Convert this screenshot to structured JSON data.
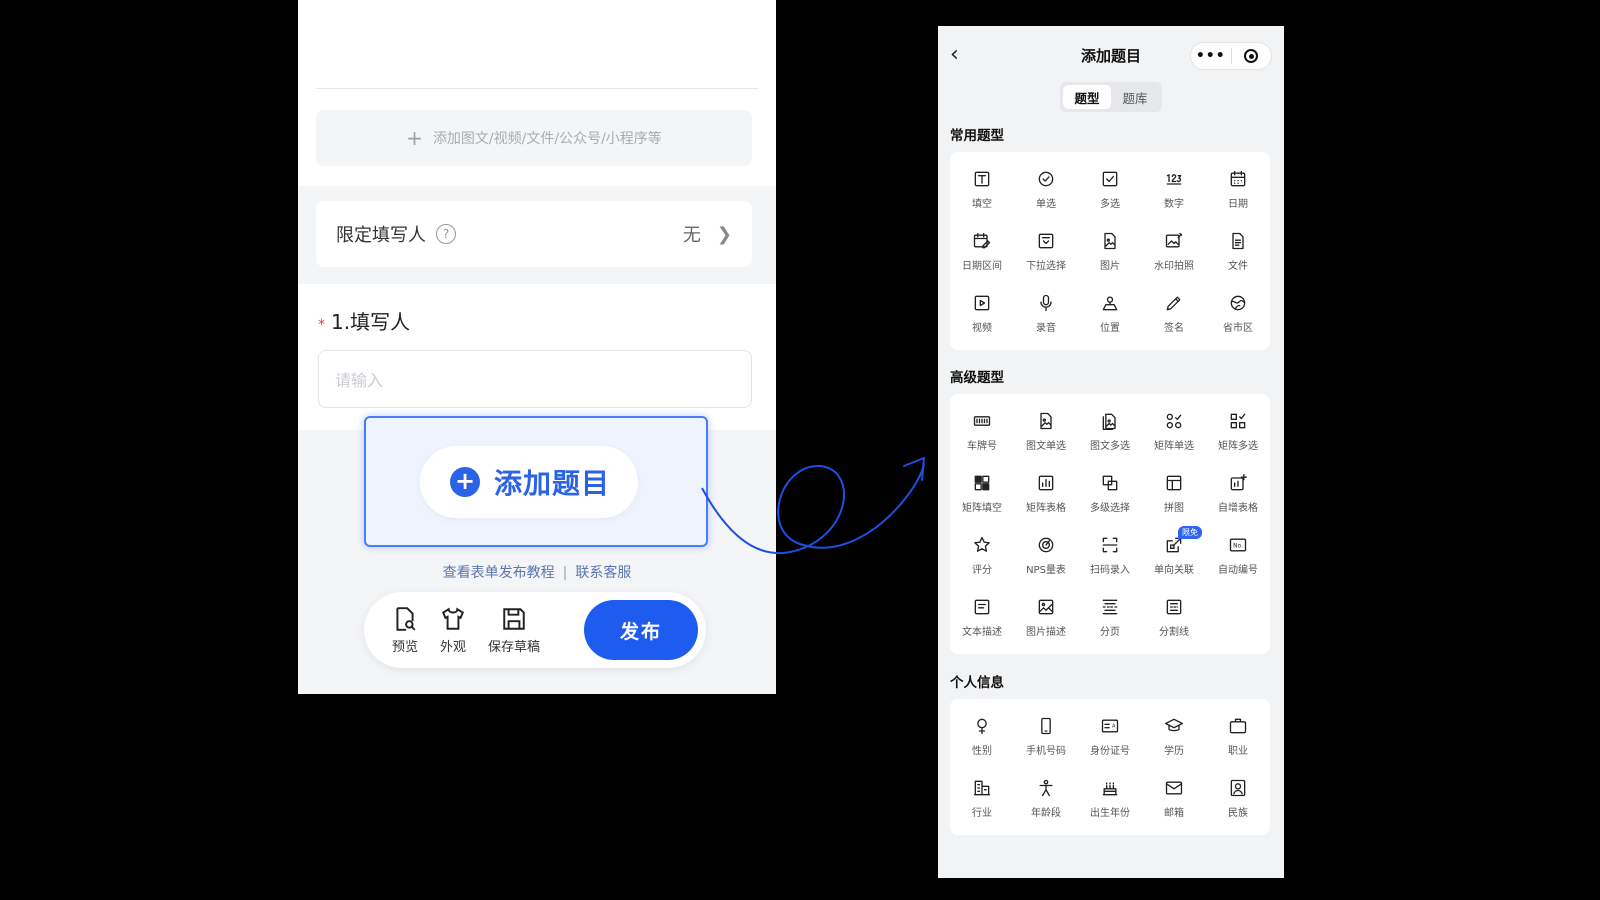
{
  "left": {
    "attach_text": "添加图文/视频/文件/公众号/小程序等",
    "limit_label": "限定填写人",
    "limit_value": "无",
    "question_title": "1.填写人",
    "required_mark": "*",
    "input_placeholder": "请输入",
    "add_question": "添加题目",
    "help_tutorial": "查看表单发布教程",
    "help_sep": "|",
    "help_contact": "联系客服",
    "toolbar": {
      "preview": "预览",
      "appearance": "外观",
      "save_draft": "保存草稿",
      "publish": "发布"
    }
  },
  "right": {
    "title": "添加题目",
    "more_icon": "•••",
    "tabs": [
      "题型",
      "题库"
    ],
    "sections": {
      "common": {
        "title": "常用题型",
        "items": [
          {
            "label": "填空",
            "icon": "text-box-icon"
          },
          {
            "label": "单选",
            "icon": "radio-check-icon"
          },
          {
            "label": "多选",
            "icon": "checkbox-icon"
          },
          {
            "label": "数字",
            "icon": "number-icon"
          },
          {
            "label": "日期",
            "icon": "calendar-icon"
          },
          {
            "label": "日期区间",
            "icon": "date-range-icon"
          },
          {
            "label": "下拉选择",
            "icon": "dropdown-icon"
          },
          {
            "label": "图片",
            "icon": "image-file-icon"
          },
          {
            "label": "水印拍照",
            "icon": "watermark-photo-icon"
          },
          {
            "label": "文件",
            "icon": "file-icon"
          },
          {
            "label": "视频",
            "icon": "video-icon"
          },
          {
            "label": "录音",
            "icon": "microphone-icon"
          },
          {
            "label": "位置",
            "icon": "location-icon"
          },
          {
            "label": "签名",
            "icon": "pen-icon"
          },
          {
            "label": "省市区",
            "icon": "globe-icon"
          }
        ]
      },
      "advanced": {
        "title": "高级题型",
        "items": [
          {
            "label": "车牌号",
            "icon": "license-plate-icon"
          },
          {
            "label": "图文单选",
            "icon": "image-text-single-icon"
          },
          {
            "label": "图文多选",
            "icon": "image-text-multi-icon"
          },
          {
            "label": "矩阵单选",
            "icon": "matrix-single-icon"
          },
          {
            "label": "矩阵多选",
            "icon": "matrix-multi-icon"
          },
          {
            "label": "矩阵填空",
            "icon": "matrix-fill-icon"
          },
          {
            "label": "矩阵表格",
            "icon": "matrix-table-icon"
          },
          {
            "label": "多级选择",
            "icon": "cascade-icon"
          },
          {
            "label": "拼图",
            "icon": "layout-icon"
          },
          {
            "label": "自增表格",
            "icon": "auto-table-icon"
          },
          {
            "label": "评分",
            "icon": "star-icon"
          },
          {
            "label": "NPS量表",
            "icon": "gauge-icon"
          },
          {
            "label": "扫码录入",
            "icon": "scan-icon"
          },
          {
            "label": "单向关联",
            "icon": "link-out-icon",
            "badge": "限免"
          },
          {
            "label": "自动编号",
            "icon": "number-no-icon"
          },
          {
            "label": "文本描述",
            "icon": "text-desc-icon"
          },
          {
            "label": "图片描述",
            "icon": "image-desc-icon"
          },
          {
            "label": "分页",
            "icon": "page-break-icon"
          },
          {
            "label": "分割线",
            "icon": "divider-icon"
          }
        ]
      },
      "personal": {
        "title": "个人信息",
        "items": [
          {
            "label": "性别",
            "icon": "gender-icon"
          },
          {
            "label": "手机号码",
            "icon": "phone-icon"
          },
          {
            "label": "身份证号",
            "icon": "id-card-icon"
          },
          {
            "label": "学历",
            "icon": "graduation-cap-icon"
          },
          {
            "label": "职业",
            "icon": "briefcase-icon"
          },
          {
            "label": "行业",
            "icon": "building-icon"
          },
          {
            "label": "年龄段",
            "icon": "person-icon"
          },
          {
            "label": "出生年份",
            "icon": "cake-icon"
          },
          {
            "label": "邮箱",
            "icon": "mail-icon"
          },
          {
            "label": "民族",
            "icon": "portrait-icon"
          }
        ]
      }
    }
  },
  "colors": {
    "primary": "#1e5cf0",
    "arrow": "#1d4fe0"
  }
}
